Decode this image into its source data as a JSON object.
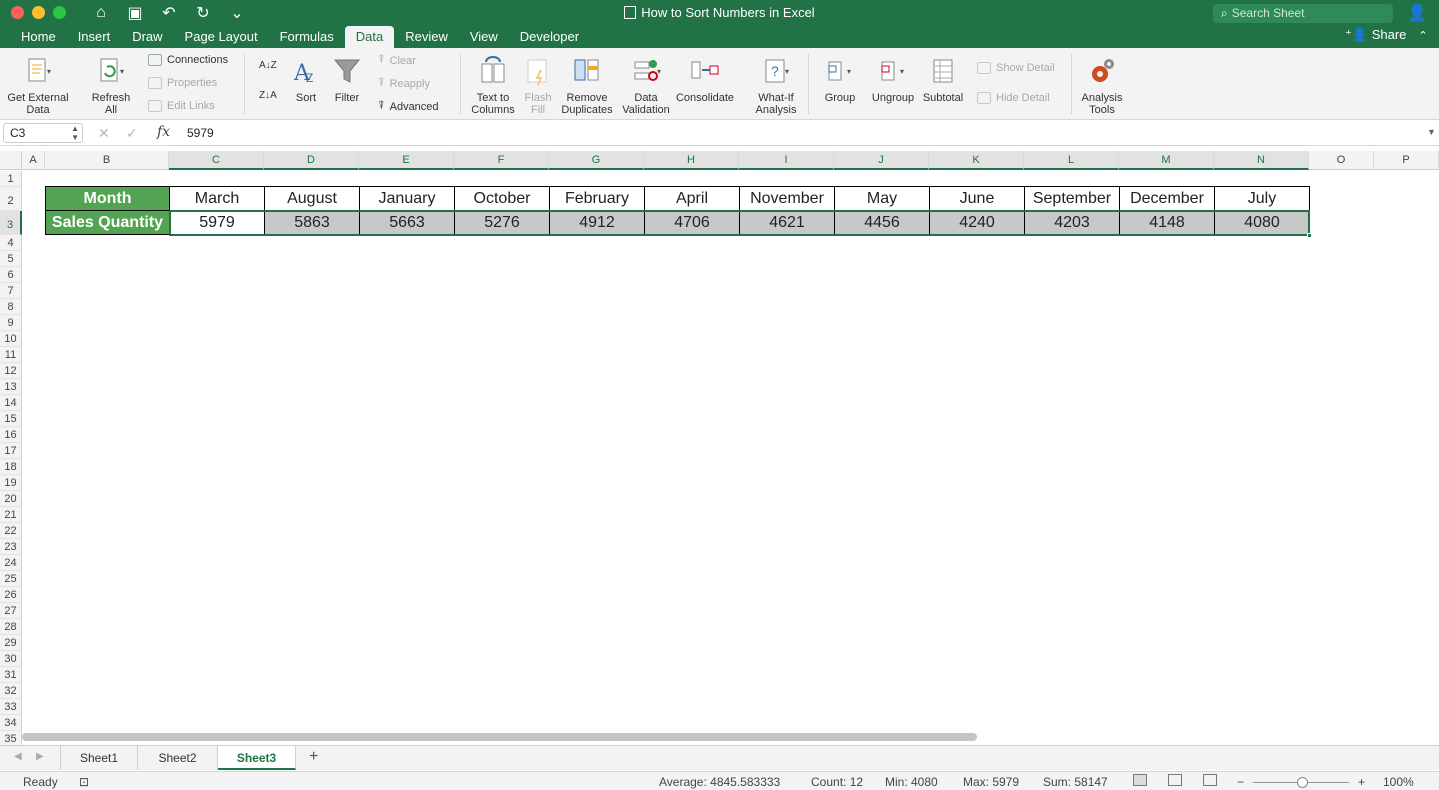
{
  "window": {
    "title": "How to Sort Numbers in Excel",
    "search_placeholder": "Search Sheet"
  },
  "tabs": [
    "Home",
    "Insert",
    "Draw",
    "Page Layout",
    "Formulas",
    "Data",
    "Review",
    "View",
    "Developer"
  ],
  "active_tab": "Data",
  "share_label": "Share",
  "ribbon": {
    "get_external_data": "Get External Data",
    "refresh_all": "Refresh All",
    "connections": "Connections",
    "properties": "Properties",
    "edit_links": "Edit Links",
    "sort": "Sort",
    "filter": "Filter",
    "clear": "Clear",
    "reapply": "Reapply",
    "advanced": "Advanced",
    "text_to_columns": "Text to Columns",
    "flash_fill": "Flash Fill",
    "remove_duplicates": "Remove Duplicates",
    "data_validation": "Data Validation",
    "consolidate": "Consolidate",
    "what_if": "What-If Analysis",
    "group": "Group",
    "ungroup": "Ungroup",
    "subtotal": "Subtotal",
    "show_detail": "Show Detail",
    "hide_detail": "Hide Detail",
    "analysis_tools": "Analysis Tools"
  },
  "formula_bar": {
    "name_box": "C3",
    "fx": "fx",
    "value": "5979"
  },
  "columns": [
    "A",
    "B",
    "C",
    "D",
    "E",
    "F",
    "G",
    "H",
    "I",
    "J",
    "K",
    "L",
    "M",
    "N",
    "O",
    "P"
  ],
  "rows": [
    "1",
    "2",
    "3",
    "4",
    "5",
    "6",
    "7",
    "8",
    "9",
    "10",
    "11",
    "12",
    "13",
    "14",
    "15",
    "16",
    "17",
    "18",
    "19",
    "20",
    "21",
    "22",
    "23",
    "24",
    "25",
    "26",
    "27",
    "28",
    "29",
    "30",
    "31",
    "32",
    "33",
    "34",
    "35"
  ],
  "table": {
    "row1_label": "Month",
    "row2_label": "Sales Quantity",
    "months": [
      "March",
      "August",
      "January",
      "October",
      "February",
      "April",
      "November",
      "May",
      "June",
      "September",
      "December",
      "July"
    ],
    "quantities": [
      "5979",
      "5863",
      "5663",
      "5276",
      "4912",
      "4706",
      "4621",
      "4456",
      "4240",
      "4203",
      "4148",
      "4080"
    ]
  },
  "sheets": [
    "Sheet1",
    "Sheet2",
    "Sheet3"
  ],
  "active_sheet": "Sheet3",
  "status": {
    "ready": "Ready",
    "average": "Average: 4845.583333",
    "count": "Count: 12",
    "min": "Min: 4080",
    "max": "Max: 5979",
    "sum": "Sum: 58147",
    "zoom": "100%",
    "zoom_minus": "−",
    "zoom_plus": "+"
  }
}
